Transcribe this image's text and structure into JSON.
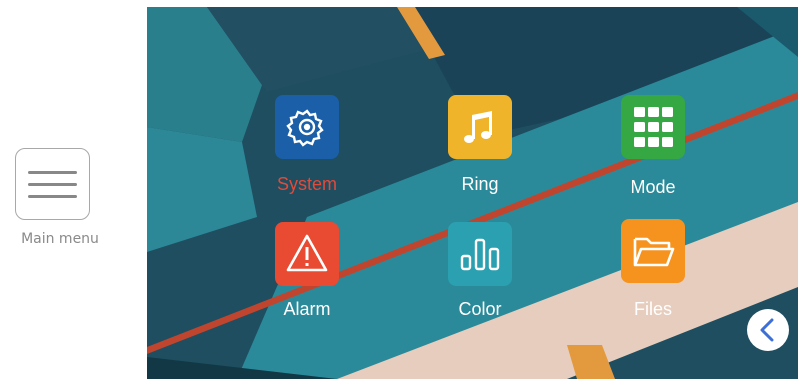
{
  "sidebar": {
    "menu_label": "Main menu",
    "menu_icon": "hamburger-menu-icon"
  },
  "apps": [
    {
      "label": "System",
      "icon": "gear-icon",
      "color": "#1a5fa8",
      "selected": true
    },
    {
      "label": "Ring",
      "icon": "music-note-icon",
      "color": "#f0b42a",
      "selected": false
    },
    {
      "label": "Mode",
      "icon": "grid-icon",
      "color": "#35a843",
      "selected": false
    },
    {
      "label": "Alarm",
      "icon": "warning-icon",
      "color": "#e84a32",
      "selected": false
    },
    {
      "label": "Color",
      "icon": "bars-icon",
      "color": "#2aa0b0",
      "selected": false
    },
    {
      "label": "Files",
      "icon": "folder-icon",
      "color": "#f5931e",
      "selected": false
    }
  ],
  "colors": {
    "selected_label": "#e24a3a",
    "label": "#ffffff",
    "back_button": "#3d6fd6"
  },
  "back_icon": "chevron-left-icon"
}
